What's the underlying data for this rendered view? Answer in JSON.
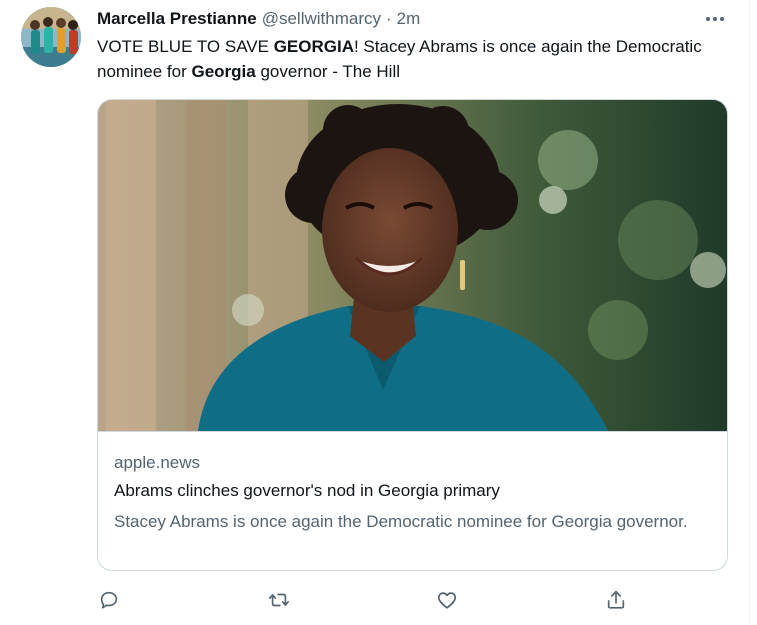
{
  "tweet": {
    "author": {
      "display_name": "Marcella Prestianne",
      "handle": "@sellwithmarcy",
      "separator": "·",
      "time": "2m",
      "avatar": "avatar-photo"
    },
    "text_parts": {
      "p1": "VOTE BLUE TO SAVE ",
      "p2": "GEORGIA",
      "p3": "! Stacey Abrams is once again the Democratic nominee for ",
      "p4": "Georgia",
      "p5": " governor - The Hill"
    },
    "card": {
      "image": "portrait-photo",
      "domain": "apple.news",
      "title": "Abrams clinches governor's nod in Georgia primary",
      "description": "Stacey Abrams is once again the Democratic nominee for Georgia governor."
    },
    "actions": [
      {
        "name": "reply",
        "icon": "reply-icon"
      },
      {
        "name": "retweet",
        "icon": "retweet-icon"
      },
      {
        "name": "like",
        "icon": "like-icon"
      },
      {
        "name": "share",
        "icon": "share-icon"
      }
    ],
    "icons": {
      "more": "more-icon"
    }
  },
  "colors": {
    "text": "#0f1419",
    "secondary": "#536471",
    "border": "#cfd9de"
  }
}
